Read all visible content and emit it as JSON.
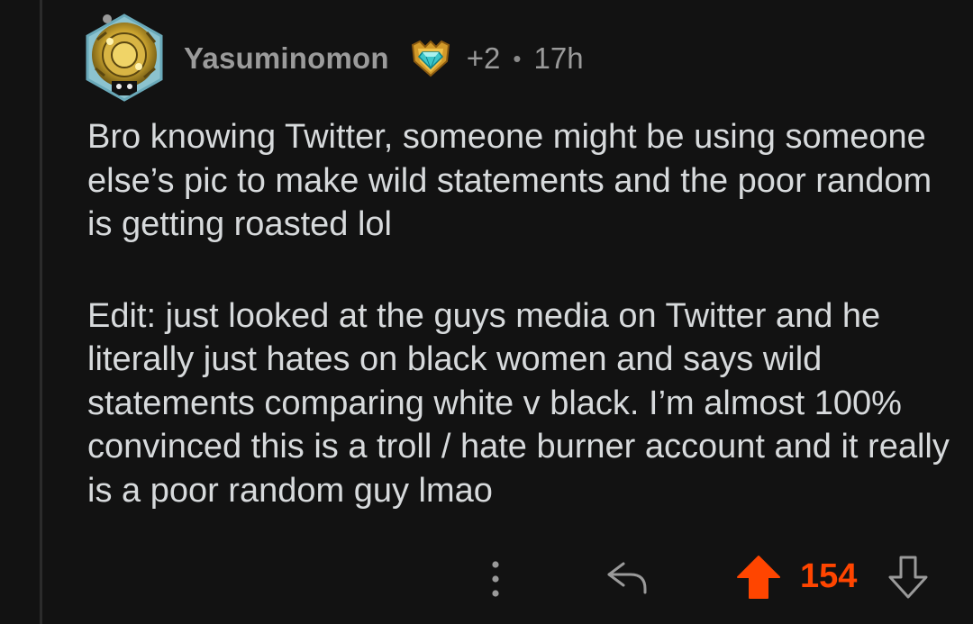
{
  "comment": {
    "author": "Yasuminomon",
    "award_count": "+2",
    "separator": "•",
    "time": "17h",
    "paragraphs": [
      "Bro knowing Twitter, someone might be using someone else’s pic to make wild statements and the poor random is getting roasted lol",
      "Edit: just looked at the guys media on Twitter and he literally just hates on black women and says wild statements comparing white v black. I’m almost 100% convinced this is a troll / hate burner account and it really is a poor random guy lmao"
    ],
    "score": "154",
    "upvoted": true
  },
  "icons": {
    "avatar": "gold-clockwork-snoo-avatar",
    "badge": "diamond-shield-badge-icon",
    "more": "vertical-ellipsis-icon",
    "reply": "reply-arrow-icon",
    "upvote": "upvote-arrow-icon",
    "downvote": "downvote-arrow-icon"
  },
  "colors": {
    "background": "#121212",
    "text": "#d7dadc",
    "meta": "#9a9a9a",
    "upvote_active": "#ff4500",
    "thread_line": "#2b2b2b"
  }
}
